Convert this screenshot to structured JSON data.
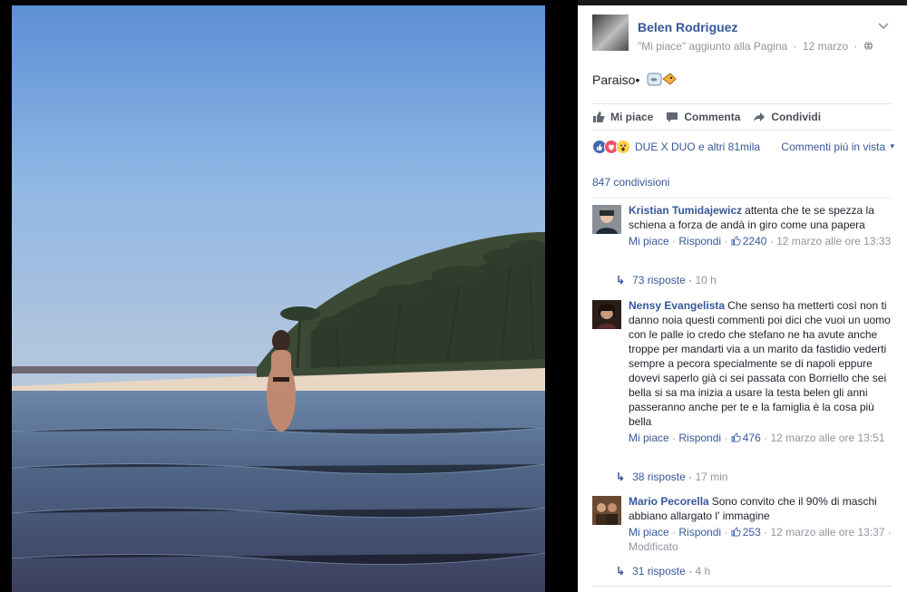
{
  "post": {
    "page_name": "Belen Rodriguez",
    "activity": "\"Mi piace\" aggiunto alla Pagina",
    "separator": "·",
    "date": "12 marzo",
    "caption": "Paraiso•"
  },
  "actions": {
    "like": "Mi piace",
    "comment": "Commenta",
    "share": "Condividi"
  },
  "reactions": {
    "summary": "DUE X DUO e altri 81mila",
    "sort": "Commenti più in vista",
    "sort_caret": "▾"
  },
  "shares": "847 condivisioni",
  "comments": [
    {
      "name": "Kristian Tumidajewicz",
      "text": "attenta che te se spezza la schiena a forza de andà in giro come una papera",
      "like": "Mi piace",
      "reply": "Rispondi",
      "likes": "2240",
      "time": "12 marzo alle ore 13:33",
      "edited": "",
      "replies": "73 risposte",
      "replies_time": "10 h"
    },
    {
      "name": "Nensy Evangelista",
      "text": "Che senso ha metterti così non ti danno noia questi commenti poi dici che vuoi un uomo con le palle io credo che stefano ne ha avute anche troppe per mandarti via a un marito da fastidio vederti sempre a pecora specialmente se di napoli eppure dovevi saperlo già ci sei passata con Borriello che sei bella si sa ma inizia a usare la testa belen gli anni passeranno anche per te e la famiglia è la cosa più bella",
      "like": "Mi piace",
      "reply": "Rispondi",
      "likes": "476",
      "time": "12 marzo alle ore 13:51",
      "edited": "",
      "replies": "38 risposte",
      "replies_time": "17 min"
    },
    {
      "name": "Mario Pecorella",
      "text": "Sono convito che il 90% di maschi abbiano allargato l' immagine",
      "like": "Mi piace",
      "reply": "Rispondi",
      "likes": "253",
      "time": "12 marzo alle ore 13:37",
      "edited": "Modificato",
      "replies": "31 risposte",
      "replies_time": "4 h"
    }
  ],
  "colors": {
    "link": "#365899",
    "meta": "#90949c",
    "text": "#1d2129",
    "like_reaction": "#4267b2",
    "love_reaction": "#f25268",
    "wow_reaction": "#fcd146"
  },
  "icons": {
    "chevron": "chevron-down-icon",
    "globe": "globe-icon",
    "like": "thumbs-up-icon",
    "comment": "comment-bubble-icon",
    "share": "share-arrow-icon",
    "reply": "reply-arrow-icon"
  }
}
